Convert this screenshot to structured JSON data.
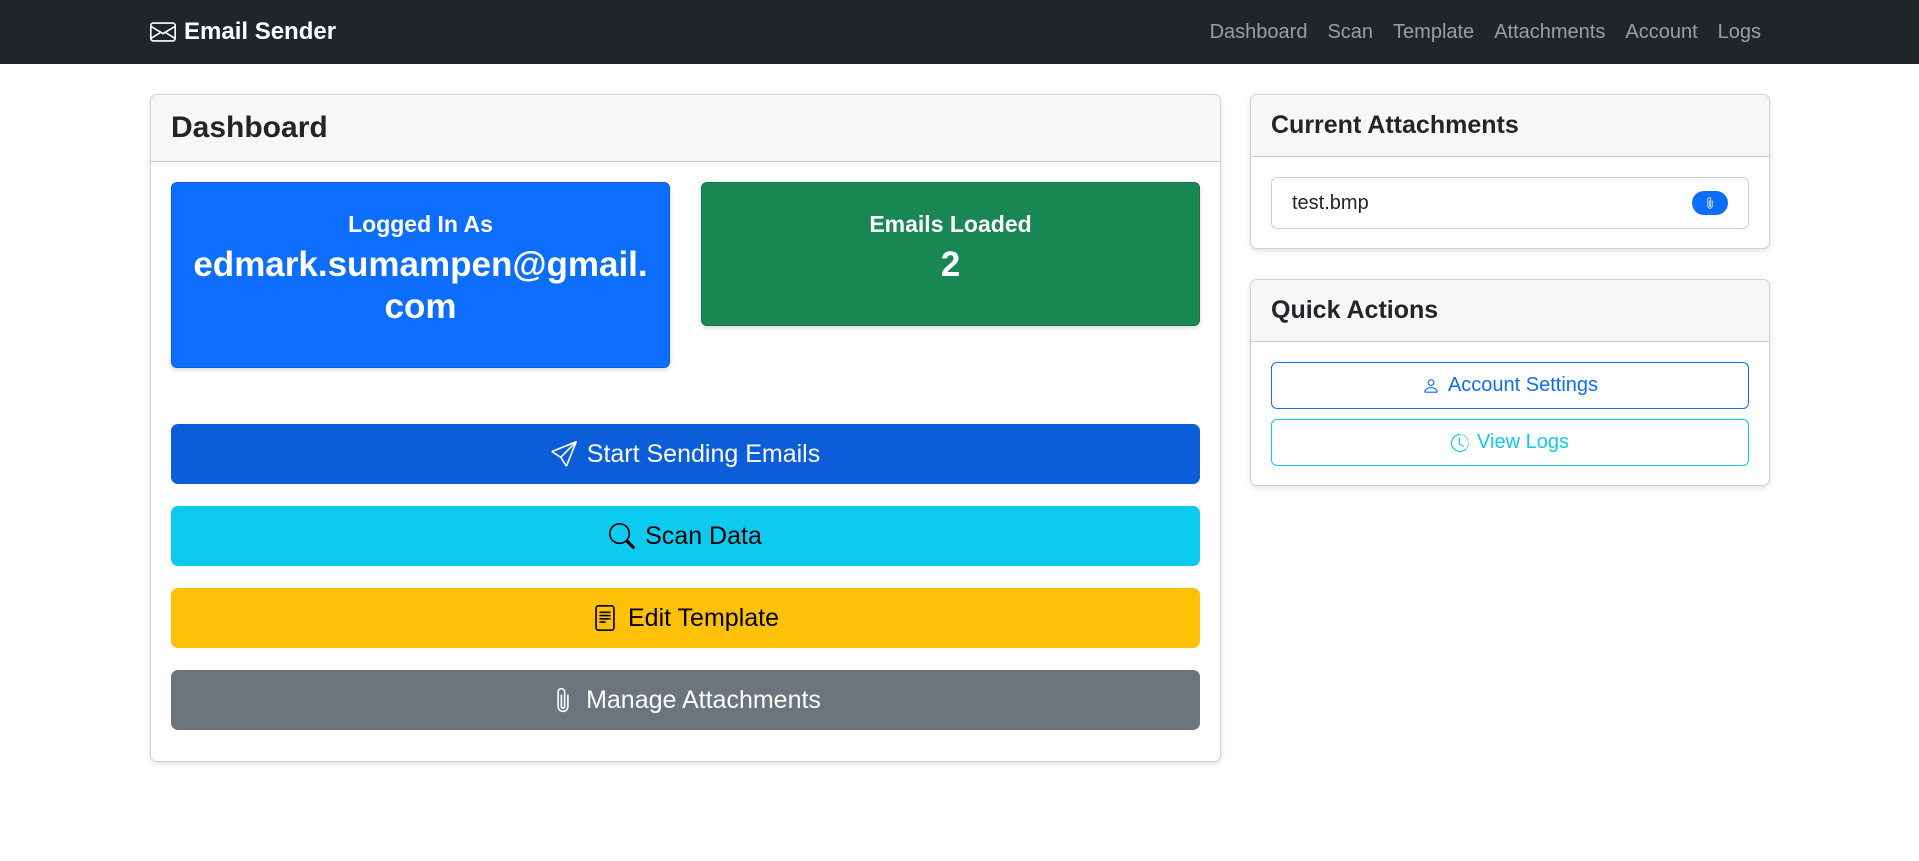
{
  "navbar": {
    "brand": "Email Sender",
    "brand_icon": "envelope-icon",
    "links": [
      "Dashboard",
      "Scan",
      "Template",
      "Attachments",
      "Account",
      "Logs"
    ]
  },
  "dashboard": {
    "title": "Dashboard",
    "logged_in_label": "Logged In As",
    "logged_in_value": "edmark.sumampen@gmail.com",
    "emails_loaded_label": "Emails Loaded",
    "emails_loaded_value": "2",
    "actions": {
      "send": "Start Sending Emails",
      "scan": "Scan Data",
      "template": "Edit Template",
      "attachments": "Manage Attachments"
    }
  },
  "attachments": {
    "title": "Current Attachments",
    "items": [
      "test.bmp"
    ]
  },
  "quick_actions": {
    "title": "Quick Actions",
    "account": "Account Settings",
    "logs": "View Logs"
  },
  "colors": {
    "navbar": "#212529",
    "primary": "#0d6efd",
    "success": "#198754",
    "info": "#0dcaf0",
    "warning": "#ffc107",
    "secondary": "#6c757d"
  }
}
